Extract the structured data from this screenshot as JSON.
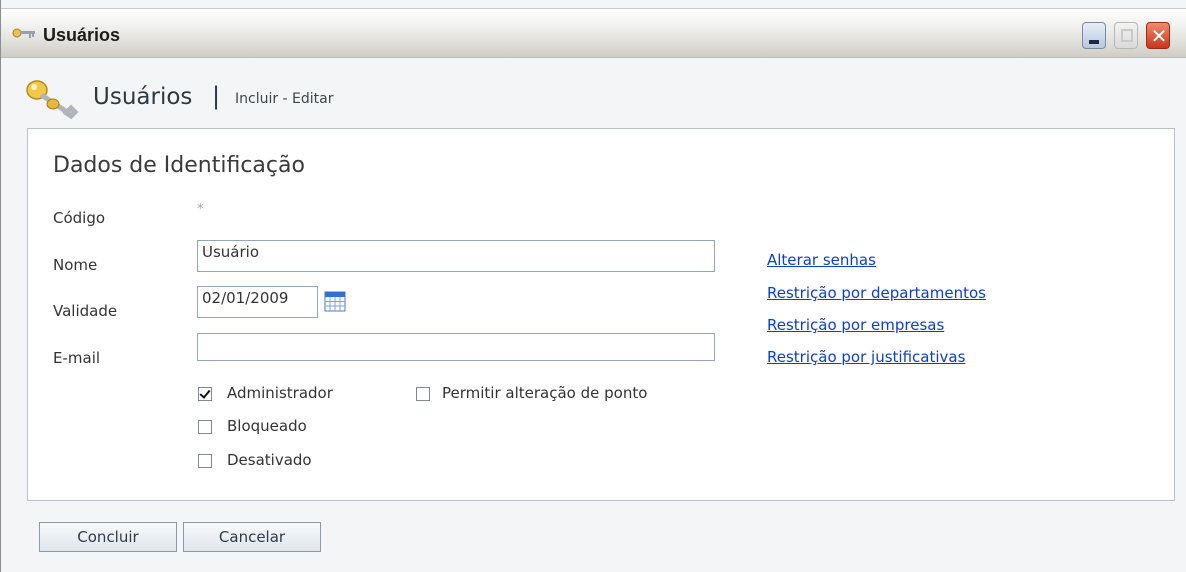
{
  "window": {
    "title": "Usuários"
  },
  "header": {
    "title": "Usuários",
    "separator": "|",
    "subtitle": "Incluir - Editar"
  },
  "section": {
    "title": "Dados de Identificação"
  },
  "form": {
    "codigo_label": "Código",
    "required_marker": "*",
    "nome_label": "Nome",
    "nome_value": "Usuário",
    "validade_label": "Validade",
    "validade_value": "02/01/2009",
    "email_label": "E-mail",
    "email_value": ""
  },
  "checkboxes": [
    {
      "label": "Administrador",
      "checked": true
    },
    {
      "label": "Bloqueado",
      "checked": false
    },
    {
      "label": "Desativado",
      "checked": false
    },
    {
      "label": "Permitir alteração de ponto",
      "checked": false
    }
  ],
  "links": [
    {
      "label": "Alterar senhas"
    },
    {
      "label": "Restrição por departamentos"
    },
    {
      "label": "Restrição por empresas"
    },
    {
      "label": "Restrição por justificativas"
    }
  ],
  "buttons": {
    "concluir": "Concluir",
    "cancelar": "Cancelar"
  },
  "icons": {
    "title": "keys-icon",
    "header": "keys-icon",
    "calendar": "calendar-icon"
  },
  "colors": {
    "link": "#0b3fd0",
    "close_button": "#c8341b"
  }
}
